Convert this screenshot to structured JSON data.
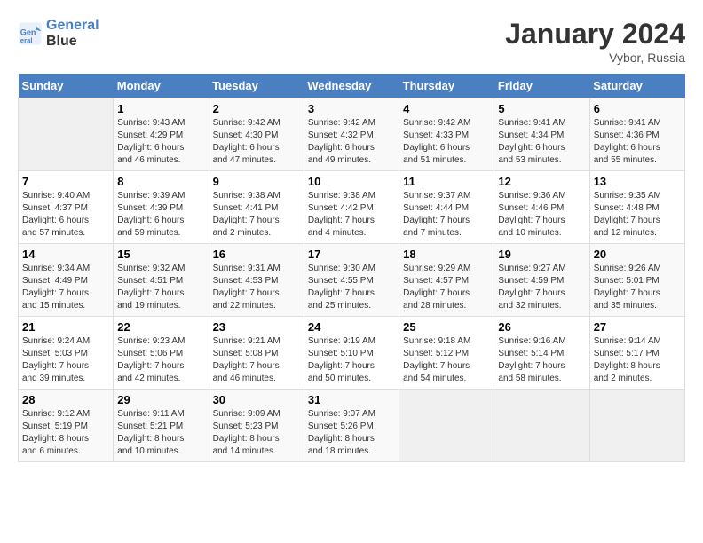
{
  "header": {
    "logo_line1": "General",
    "logo_line2": "Blue",
    "month": "January 2024",
    "location": "Vybor, Russia"
  },
  "days_of_week": [
    "Sunday",
    "Monday",
    "Tuesday",
    "Wednesday",
    "Thursday",
    "Friday",
    "Saturday"
  ],
  "weeks": [
    [
      {
        "day": "",
        "info": ""
      },
      {
        "day": "1",
        "info": "Sunrise: 9:43 AM\nSunset: 4:29 PM\nDaylight: 6 hours\nand 46 minutes."
      },
      {
        "day": "2",
        "info": "Sunrise: 9:42 AM\nSunset: 4:30 PM\nDaylight: 6 hours\nand 47 minutes."
      },
      {
        "day": "3",
        "info": "Sunrise: 9:42 AM\nSunset: 4:32 PM\nDaylight: 6 hours\nand 49 minutes."
      },
      {
        "day": "4",
        "info": "Sunrise: 9:42 AM\nSunset: 4:33 PM\nDaylight: 6 hours\nand 51 minutes."
      },
      {
        "day": "5",
        "info": "Sunrise: 9:41 AM\nSunset: 4:34 PM\nDaylight: 6 hours\nand 53 minutes."
      },
      {
        "day": "6",
        "info": "Sunrise: 9:41 AM\nSunset: 4:36 PM\nDaylight: 6 hours\nand 55 minutes."
      }
    ],
    [
      {
        "day": "7",
        "info": "Sunrise: 9:40 AM\nSunset: 4:37 PM\nDaylight: 6 hours\nand 57 minutes."
      },
      {
        "day": "8",
        "info": "Sunrise: 9:39 AM\nSunset: 4:39 PM\nDaylight: 6 hours\nand 59 minutes."
      },
      {
        "day": "9",
        "info": "Sunrise: 9:38 AM\nSunset: 4:41 PM\nDaylight: 7 hours\nand 2 minutes."
      },
      {
        "day": "10",
        "info": "Sunrise: 9:38 AM\nSunset: 4:42 PM\nDaylight: 7 hours\nand 4 minutes."
      },
      {
        "day": "11",
        "info": "Sunrise: 9:37 AM\nSunset: 4:44 PM\nDaylight: 7 hours\nand 7 minutes."
      },
      {
        "day": "12",
        "info": "Sunrise: 9:36 AM\nSunset: 4:46 PM\nDaylight: 7 hours\nand 10 minutes."
      },
      {
        "day": "13",
        "info": "Sunrise: 9:35 AM\nSunset: 4:48 PM\nDaylight: 7 hours\nand 12 minutes."
      }
    ],
    [
      {
        "day": "14",
        "info": "Sunrise: 9:34 AM\nSunset: 4:49 PM\nDaylight: 7 hours\nand 15 minutes."
      },
      {
        "day": "15",
        "info": "Sunrise: 9:32 AM\nSunset: 4:51 PM\nDaylight: 7 hours\nand 19 minutes."
      },
      {
        "day": "16",
        "info": "Sunrise: 9:31 AM\nSunset: 4:53 PM\nDaylight: 7 hours\nand 22 minutes."
      },
      {
        "day": "17",
        "info": "Sunrise: 9:30 AM\nSunset: 4:55 PM\nDaylight: 7 hours\nand 25 minutes."
      },
      {
        "day": "18",
        "info": "Sunrise: 9:29 AM\nSunset: 4:57 PM\nDaylight: 7 hours\nand 28 minutes."
      },
      {
        "day": "19",
        "info": "Sunrise: 9:27 AM\nSunset: 4:59 PM\nDaylight: 7 hours\nand 32 minutes."
      },
      {
        "day": "20",
        "info": "Sunrise: 9:26 AM\nSunset: 5:01 PM\nDaylight: 7 hours\nand 35 minutes."
      }
    ],
    [
      {
        "day": "21",
        "info": "Sunrise: 9:24 AM\nSunset: 5:03 PM\nDaylight: 7 hours\nand 39 minutes."
      },
      {
        "day": "22",
        "info": "Sunrise: 9:23 AM\nSunset: 5:06 PM\nDaylight: 7 hours\nand 42 minutes."
      },
      {
        "day": "23",
        "info": "Sunrise: 9:21 AM\nSunset: 5:08 PM\nDaylight: 7 hours\nand 46 minutes."
      },
      {
        "day": "24",
        "info": "Sunrise: 9:19 AM\nSunset: 5:10 PM\nDaylight: 7 hours\nand 50 minutes."
      },
      {
        "day": "25",
        "info": "Sunrise: 9:18 AM\nSunset: 5:12 PM\nDaylight: 7 hours\nand 54 minutes."
      },
      {
        "day": "26",
        "info": "Sunrise: 9:16 AM\nSunset: 5:14 PM\nDaylight: 7 hours\nand 58 minutes."
      },
      {
        "day": "27",
        "info": "Sunrise: 9:14 AM\nSunset: 5:17 PM\nDaylight: 8 hours\nand 2 minutes."
      }
    ],
    [
      {
        "day": "28",
        "info": "Sunrise: 9:12 AM\nSunset: 5:19 PM\nDaylight: 8 hours\nand 6 minutes."
      },
      {
        "day": "29",
        "info": "Sunrise: 9:11 AM\nSunset: 5:21 PM\nDaylight: 8 hours\nand 10 minutes."
      },
      {
        "day": "30",
        "info": "Sunrise: 9:09 AM\nSunset: 5:23 PM\nDaylight: 8 hours\nand 14 minutes."
      },
      {
        "day": "31",
        "info": "Sunrise: 9:07 AM\nSunset: 5:26 PM\nDaylight: 8 hours\nand 18 minutes."
      },
      {
        "day": "",
        "info": ""
      },
      {
        "day": "",
        "info": ""
      },
      {
        "day": "",
        "info": ""
      }
    ]
  ]
}
